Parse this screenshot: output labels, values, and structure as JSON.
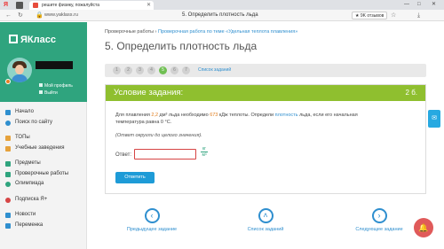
{
  "browser": {
    "tab_title": "решите физику, пожалуйста",
    "url": "www.yaklass.ru",
    "center_title": "5. Определить плотность льда",
    "reviews_label": "★ 9K отзывов"
  },
  "sidebar": {
    "logo_text": "ЯКласс",
    "profile_link": "Мой профиль",
    "logout_link": "Выйти",
    "items": [
      {
        "label": "Начало",
        "icon": "home-icon",
        "color": "#2f8fcf"
      },
      {
        "label": "Поиск по сайту",
        "icon": "search-icon",
        "color": "#2f8fcf"
      },
      {
        "label": "ТОПы",
        "icon": "trophy-icon",
        "color": "#e6a23c"
      },
      {
        "label": "Учебные заведения",
        "icon": "school-icon",
        "color": "#e6a23c"
      },
      {
        "label": "Предметы",
        "icon": "books-icon",
        "color": "#2fa47e"
      },
      {
        "label": "Проверочные работы",
        "icon": "tests-icon",
        "color": "#2fa47e"
      },
      {
        "label": "Олимпиада",
        "icon": "olympiad-icon",
        "color": "#2fa47e"
      },
      {
        "label": "Подписка Я+",
        "icon": "subscription-icon",
        "color": "#d64545"
      },
      {
        "label": "Новости",
        "icon": "news-icon",
        "color": "#2f8fcf"
      },
      {
        "label": "Переменка",
        "icon": "break-icon",
        "color": "#2f8fcf"
      }
    ]
  },
  "main": {
    "crumb_1": "Проверочные работы",
    "crumb_sep": "›",
    "crumb_2": "Проверочная работа по теме «Удельная теплота плавления»",
    "title": "5. Определить плотность льда",
    "steps": [
      "1",
      "2",
      "3",
      "4",
      "5",
      "6",
      "7"
    ],
    "active_step": 5,
    "steps_list_link": "Список заданий",
    "task_header": "Условие задания:",
    "task_points": "2 б.",
    "q_part1": "Для плавления ",
    "q_vol": "2,2",
    "q_part2": " дм³ льда необходимо ",
    "q_energy": "673",
    "q_part3": " кДж теплоты. Определи ",
    "q_link": "плотность",
    "q_part4": " льда, если его начальная",
    "q_line2": "температура равна 0 °C.",
    "note": "(Ответ округли до целого значения).",
    "answer_label": "Ответ:",
    "unit_num": "кг",
    "unit_den": "м³",
    "submit_label": "Ответить",
    "nav_prev": "Предыдущее задание",
    "nav_list": "Список заданий",
    "nav_next": "Следующее задание"
  }
}
